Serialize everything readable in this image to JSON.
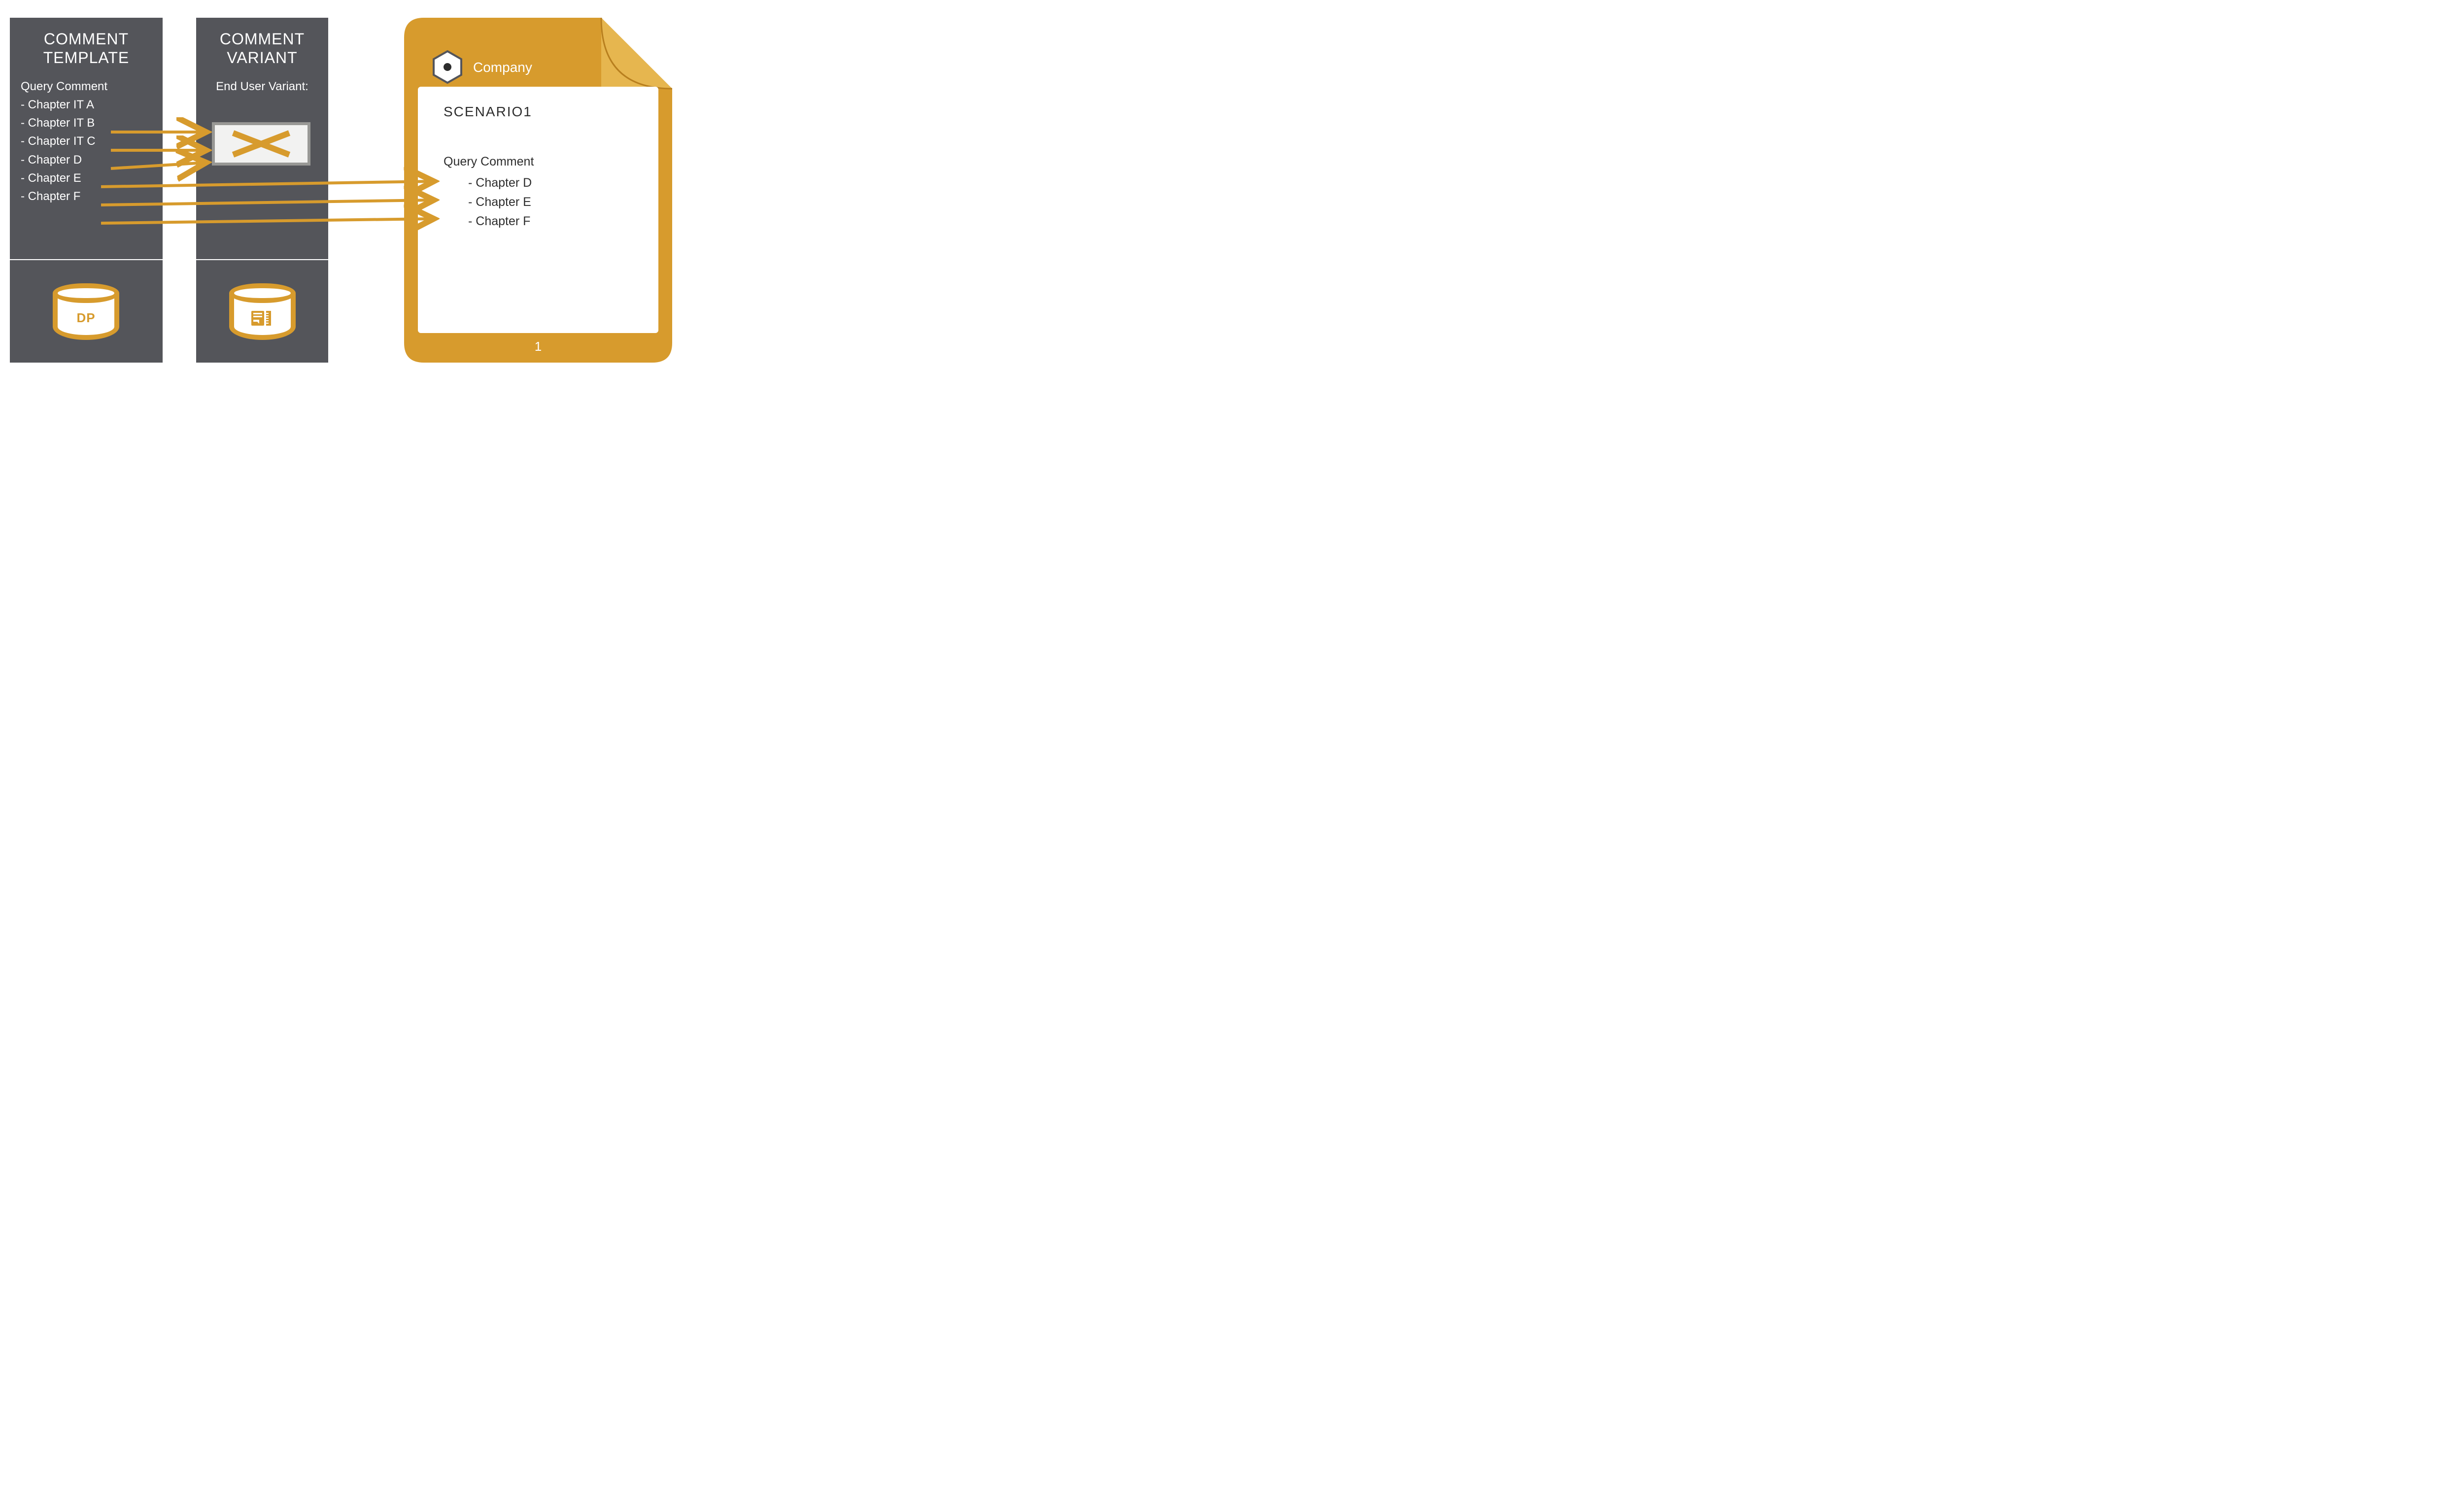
{
  "colors": {
    "panel": "#54555a",
    "accent": "#d79b2d",
    "accent_light": "#e6b64f",
    "text_dark": "#2d2d2d"
  },
  "template_panel": {
    "title_line1": "COMMENT",
    "title_line2": "TEMPLATE",
    "subheader": "Query Comment",
    "chapters": [
      "- Chapter IT A",
      "- Chapter IT B",
      "- Chapter IT C",
      "- Chapter D",
      "- Chapter E",
      "- Chapter F"
    ],
    "db_label": "DP"
  },
  "variant_panel": {
    "title_line1": "COMMENT",
    "title_line2": "VARIANT",
    "subheader": "End User Variant:",
    "box_icon": "cross-icon"
  },
  "document": {
    "company_label": "Company",
    "scenario_title": "SCENARIO1",
    "subheader": "Query Comment",
    "chapters": [
      "- Chapter D",
      "- Chapter E",
      "- Chapter F"
    ],
    "page_number": "1"
  },
  "arrows": {
    "to_variant": [
      "Chapter IT A",
      "Chapter IT B",
      "Chapter IT C"
    ],
    "to_document": [
      "Chapter D",
      "Chapter E",
      "Chapter F"
    ]
  }
}
